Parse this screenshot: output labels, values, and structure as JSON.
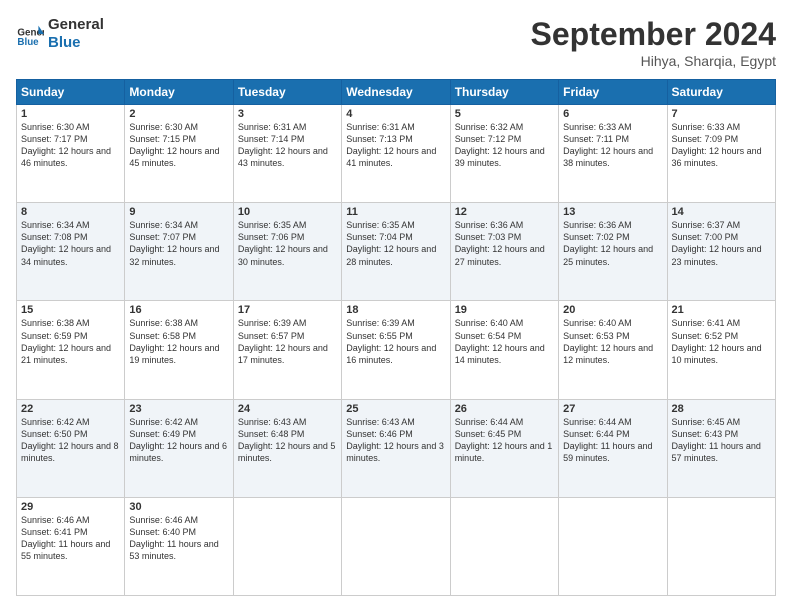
{
  "header": {
    "logo_line1": "General",
    "logo_line2": "Blue",
    "month": "September 2024",
    "location": "Hihya, Sharqia, Egypt"
  },
  "weekdays": [
    "Sunday",
    "Monday",
    "Tuesday",
    "Wednesday",
    "Thursday",
    "Friday",
    "Saturday"
  ],
  "weeks": [
    [
      {
        "day": "1",
        "sunrise": "6:30 AM",
        "sunset": "7:17 PM",
        "daylight": "12 hours and 46 minutes."
      },
      {
        "day": "2",
        "sunrise": "6:30 AM",
        "sunset": "7:15 PM",
        "daylight": "12 hours and 45 minutes."
      },
      {
        "day": "3",
        "sunrise": "6:31 AM",
        "sunset": "7:14 PM",
        "daylight": "12 hours and 43 minutes."
      },
      {
        "day": "4",
        "sunrise": "6:31 AM",
        "sunset": "7:13 PM",
        "daylight": "12 hours and 41 minutes."
      },
      {
        "day": "5",
        "sunrise": "6:32 AM",
        "sunset": "7:12 PM",
        "daylight": "12 hours and 39 minutes."
      },
      {
        "day": "6",
        "sunrise": "6:33 AM",
        "sunset": "7:11 PM",
        "daylight": "12 hours and 38 minutes."
      },
      {
        "day": "7",
        "sunrise": "6:33 AM",
        "sunset": "7:09 PM",
        "daylight": "12 hours and 36 minutes."
      }
    ],
    [
      {
        "day": "8",
        "sunrise": "6:34 AM",
        "sunset": "7:08 PM",
        "daylight": "12 hours and 34 minutes."
      },
      {
        "day": "9",
        "sunrise": "6:34 AM",
        "sunset": "7:07 PM",
        "daylight": "12 hours and 32 minutes."
      },
      {
        "day": "10",
        "sunrise": "6:35 AM",
        "sunset": "7:06 PM",
        "daylight": "12 hours and 30 minutes."
      },
      {
        "day": "11",
        "sunrise": "6:35 AM",
        "sunset": "7:04 PM",
        "daylight": "12 hours and 28 minutes."
      },
      {
        "day": "12",
        "sunrise": "6:36 AM",
        "sunset": "7:03 PM",
        "daylight": "12 hours and 27 minutes."
      },
      {
        "day": "13",
        "sunrise": "6:36 AM",
        "sunset": "7:02 PM",
        "daylight": "12 hours and 25 minutes."
      },
      {
        "day": "14",
        "sunrise": "6:37 AM",
        "sunset": "7:00 PM",
        "daylight": "12 hours and 23 minutes."
      }
    ],
    [
      {
        "day": "15",
        "sunrise": "6:38 AM",
        "sunset": "6:59 PM",
        "daylight": "12 hours and 21 minutes."
      },
      {
        "day": "16",
        "sunrise": "6:38 AM",
        "sunset": "6:58 PM",
        "daylight": "12 hours and 19 minutes."
      },
      {
        "day": "17",
        "sunrise": "6:39 AM",
        "sunset": "6:57 PM",
        "daylight": "12 hours and 17 minutes."
      },
      {
        "day": "18",
        "sunrise": "6:39 AM",
        "sunset": "6:55 PM",
        "daylight": "12 hours and 16 minutes."
      },
      {
        "day": "19",
        "sunrise": "6:40 AM",
        "sunset": "6:54 PM",
        "daylight": "12 hours and 14 minutes."
      },
      {
        "day": "20",
        "sunrise": "6:40 AM",
        "sunset": "6:53 PM",
        "daylight": "12 hours and 12 minutes."
      },
      {
        "day": "21",
        "sunrise": "6:41 AM",
        "sunset": "6:52 PM",
        "daylight": "12 hours and 10 minutes."
      }
    ],
    [
      {
        "day": "22",
        "sunrise": "6:42 AM",
        "sunset": "6:50 PM",
        "daylight": "12 hours and 8 minutes."
      },
      {
        "day": "23",
        "sunrise": "6:42 AM",
        "sunset": "6:49 PM",
        "daylight": "12 hours and 6 minutes."
      },
      {
        "day": "24",
        "sunrise": "6:43 AM",
        "sunset": "6:48 PM",
        "daylight": "12 hours and 5 minutes."
      },
      {
        "day": "25",
        "sunrise": "6:43 AM",
        "sunset": "6:46 PM",
        "daylight": "12 hours and 3 minutes."
      },
      {
        "day": "26",
        "sunrise": "6:44 AM",
        "sunset": "6:45 PM",
        "daylight": "12 hours and 1 minute."
      },
      {
        "day": "27",
        "sunrise": "6:44 AM",
        "sunset": "6:44 PM",
        "daylight": "11 hours and 59 minutes."
      },
      {
        "day": "28",
        "sunrise": "6:45 AM",
        "sunset": "6:43 PM",
        "daylight": "11 hours and 57 minutes."
      }
    ],
    [
      {
        "day": "29",
        "sunrise": "6:46 AM",
        "sunset": "6:41 PM",
        "daylight": "11 hours and 55 minutes."
      },
      {
        "day": "30",
        "sunrise": "6:46 AM",
        "sunset": "6:40 PM",
        "daylight": "11 hours and 53 minutes."
      },
      null,
      null,
      null,
      null,
      null
    ]
  ]
}
